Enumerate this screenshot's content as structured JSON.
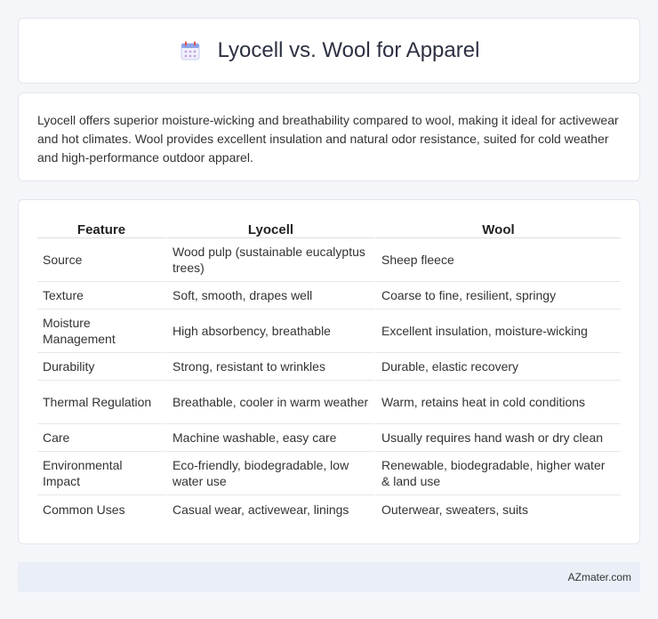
{
  "header": {
    "icon": "calendar-icon",
    "title": "Lyocell vs. Wool for Apparel"
  },
  "summary": "Lyocell offers superior moisture-wicking and breathability compared to wool, making it ideal for activewear and hot climates. Wool provides excellent insulation and natural odor resistance, suited for cold weather and high-performance outdoor apparel.",
  "table": {
    "headers": [
      "Feature",
      "Lyocell",
      "Wool"
    ],
    "rows": [
      [
        "Source",
        "Wood pulp (sustainable eucalyptus trees)",
        "Sheep fleece"
      ],
      [
        "Texture",
        "Soft, smooth, drapes well",
        "Coarse to fine, resilient, springy"
      ],
      [
        "Moisture Management",
        "High absorbency, breathable",
        "Excellent insulation, moisture-wicking"
      ],
      [
        "Durability",
        "Strong, resistant to wrinkles",
        "Durable, elastic recovery"
      ],
      [
        "Thermal Regulation",
        "Breathable, cooler in warm weather",
        "Warm, retains heat in cold conditions"
      ],
      [
        "Care",
        "Machine washable, easy care",
        "Usually requires hand wash or dry clean"
      ],
      [
        "Environmental Impact",
        "Eco-friendly, biodegradable, low water use",
        "Renewable, biodegradable, higher water & land use"
      ],
      [
        "Common Uses",
        "Casual wear, activewear, linings",
        "Outerwear, sweaters, suits"
      ]
    ]
  },
  "footer": {
    "brand": "AZmater.com"
  },
  "colors": {
    "page_bg": "#f5f6fa",
    "footer_bg": "#e9eef7",
    "icon_accent": "#7b8cde"
  }
}
